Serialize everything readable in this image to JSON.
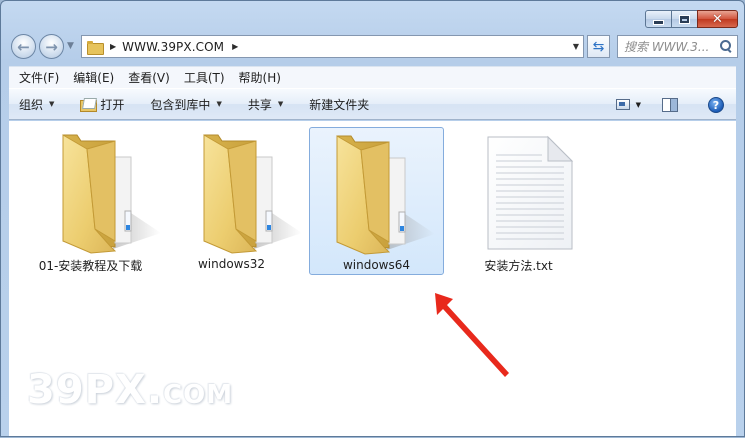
{
  "window": {
    "caption": {
      "minimize_glyph": "minimize-icon",
      "maximize_glyph": "maximize-icon",
      "close_glyph": "✕"
    }
  },
  "nav": {
    "address_path": "WWW.39PX.COM",
    "search_placeholder": "搜索 WWW.3..."
  },
  "menubar": {
    "items": [
      {
        "label": "文件(F)"
      },
      {
        "label": "编辑(E)"
      },
      {
        "label": "查看(V)"
      },
      {
        "label": "工具(T)"
      },
      {
        "label": "帮助(H)"
      }
    ]
  },
  "toolbar": {
    "organize": "组织",
    "open": "打开",
    "include_library": "包含到库中",
    "share": "共享",
    "new_folder": "新建文件夹",
    "help": "?"
  },
  "files": [
    {
      "name": "01-安装教程及下载",
      "type": "folder",
      "selected": false
    },
    {
      "name": "windows32",
      "type": "folder",
      "selected": false
    },
    {
      "name": "windows64",
      "type": "folder",
      "selected": true
    },
    {
      "name": "安装方法.txt",
      "type": "text-document",
      "selected": false
    }
  ],
  "watermark": {
    "main": "39PX.",
    "suffix": "COM"
  },
  "colors": {
    "selection_fill": "#d3e7fb",
    "selection_border": "#84acdd",
    "annotation_arrow": "#e8291c",
    "folder": "#eccd6f"
  }
}
